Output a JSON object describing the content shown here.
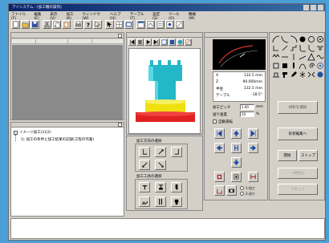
{
  "titlebar": {
    "title": "アイシステム - [加工機の操作]"
  },
  "menubar": {
    "items": [
      "ファイル(F)",
      "編集(E)",
      "表示(V)",
      "加工(K)",
      "ウィンドウ(W)",
      "ヘルプ(H)",
      "テーブル(T)",
      "設定(S)",
      "ツール(O)",
      "機械(M)",
      "ログ(L)",
      "ヘルプ"
    ]
  },
  "tree": {
    "root_label": "イメージ加工(1)(2)",
    "child_label": "加工の条件と加工結果の記録(工程の作業)",
    "child_prefix": "1)"
  },
  "readout": {
    "x_label": "X",
    "x_value": "132.5 mm",
    "z_label": "Z",
    "z_value": "90.000mm",
    "r_label": "半径",
    "r_value": "132.5 mm",
    "t_label": "テーブル",
    "t_value": "-18.5°",
    "row1_label": "加工ピッチ",
    "row1_value": "1.00",
    "row1_unit": "mm",
    "row2_label": "送り速度",
    "row2_value": "10",
    "row2_unit": "%",
    "check_label": "自動運転",
    "opt1": "1-加工",
    "opt2": "2-送り"
  },
  "tool_panel": {
    "section1_label": "加工方向の選択",
    "section2_label": "加工工具の選択"
  },
  "right_panel": {
    "btn1": "材料を選択",
    "btn2": "形状編集へ",
    "btn3": "開始",
    "btn4": "ストップ",
    "btn5": "一時停止",
    "btn6": "リセット"
  },
  "colors": {
    "desktop": "#4a9fd6",
    "window_bg": "#d4d0c8",
    "title_bar": "#0a246a",
    "cylinder": "#22b8c8",
    "yellow": "#f0e010",
    "red": "#e02020"
  }
}
